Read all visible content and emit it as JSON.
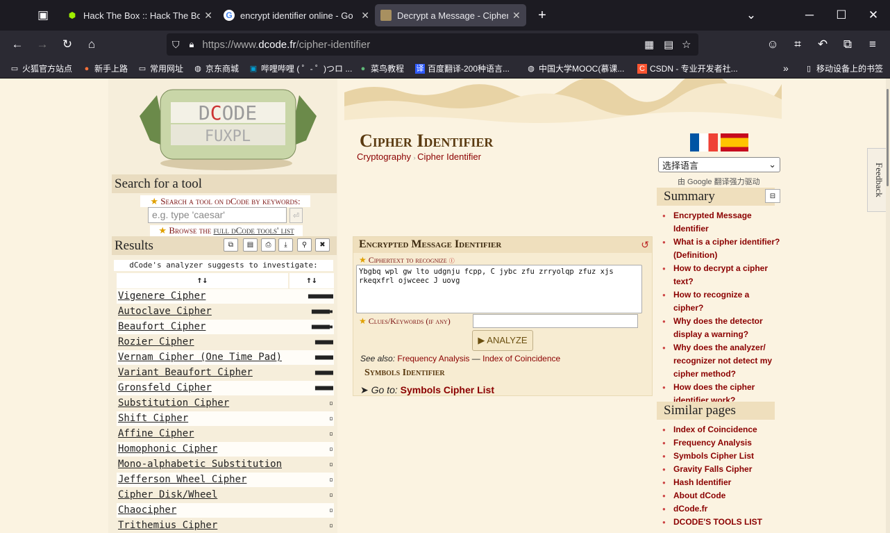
{
  "browser": {
    "tabs": [
      {
        "title": "Hack The Box :: Hack The Box",
        "favicon": "box-icon"
      },
      {
        "title": "encrypt identifier online - Go",
        "favicon": "google-icon"
      },
      {
        "title": "Decrypt a Message - Cipher I",
        "favicon": "dcode-icon"
      }
    ],
    "url_prefix": "https://www.",
    "url_domain": "dcode.fr",
    "url_path": "/cipher-identifier",
    "bookmarks": [
      "火狐官方站点",
      "新手上路",
      "常用网址",
      "京东商城",
      "哔哩哔哩 ( ゜- ゜)つロ ...",
      "菜鸟教程",
      "百度翻译-200种语言...",
      "中国大学MOOC(慕课...",
      "CSDN - 专业开发者社...",
      "移动设备上的书签"
    ]
  },
  "feedback": "Feedback",
  "left": {
    "search_title": "Search for a tool",
    "search_label": "Search a tool on dCode by keywords:",
    "search_placeholder": "e.g. type 'caesar'",
    "browse_prefix": "Browse the ",
    "browse_link": "full dCode tools' list",
    "results_title": "Results",
    "suggest": "dCode's analyzer suggests to investigate:",
    "col_name": "↑↓",
    "col_score": "↑↓",
    "results": [
      {
        "name": "Vigenere Cipher",
        "score": "■■■■■■■"
      },
      {
        "name": "Autoclave Cipher",
        "score": "■■■■■▪"
      },
      {
        "name": "Beaufort Cipher",
        "score": "■■■■■▪"
      },
      {
        "name": "Rozier Cipher",
        "score": "■■■■■"
      },
      {
        "name": "Vernam Cipher (One Time Pad)",
        "score": "■■■■■"
      },
      {
        "name": "Variant Beaufort Cipher",
        "score": "■■■■■"
      },
      {
        "name": "Gronsfeld Cipher",
        "score": "■■■■■"
      },
      {
        "name": "Substitution Cipher",
        "score": "▫"
      },
      {
        "name": "Shift Cipher",
        "score": "▫"
      },
      {
        "name": "Affine Cipher",
        "score": "▫"
      },
      {
        "name": "Homophonic Cipher",
        "score": "▫"
      },
      {
        "name": "Mono-alphabetic Substitution",
        "score": "▫"
      },
      {
        "name": "Jefferson Wheel Cipher",
        "score": "▫"
      },
      {
        "name": "Cipher Disk/Wheel",
        "score": "▫"
      },
      {
        "name": "Chaocipher",
        "score": "▫"
      },
      {
        "name": "Trithemius Cipher",
        "score": "▫"
      }
    ]
  },
  "main": {
    "title": "Cipher Identifier",
    "crumb1": "Cryptography",
    "crumb2": "Cipher Identifier",
    "tool_title": "Encrypted Message Identifier",
    "ciphertext_label": "Ciphertext to recognize",
    "ciphertext": "Ybgbq wpl gw lto udgnju fcpp, C jybc zfu zrryolqp zfuz xjs rkeqxfrl ojwceec J uovg",
    "clues_label": "Clues/Keywords (if any)",
    "analyze": "▶ ANALYZE",
    "see_also": "See also: ",
    "see1": "Frequency Analysis",
    "see_sep": " — ",
    "see2": "Index of Coincidence",
    "symbols_title": "Symbols Identifier",
    "goto": "➤ Go to: ",
    "goto_link": "Symbols Cipher List"
  },
  "right": {
    "lang_select": "选择语言",
    "google_power": "由 Google 翻译强力驱动",
    "summary_title": "Summary",
    "summary": [
      "Encrypted Message Identifier",
      "What is a cipher identifier? (Definition)",
      "How to decrypt a cipher text?",
      "How to recognize a cipher?",
      "Why does the detector display a warning?",
      "Why does the analyzer/ recognizer not detect my cipher method?",
      "How does the cipher identifier work?"
    ],
    "similar_title": "Similar pages",
    "similar": [
      "Index of Coincidence",
      "Frequency Analysis",
      "Symbols Cipher List",
      "Gravity Falls Cipher",
      "Hash Identifier",
      "About dCode",
      "dCode.fr",
      "DCODE'S TOOLS LIST"
    ]
  }
}
